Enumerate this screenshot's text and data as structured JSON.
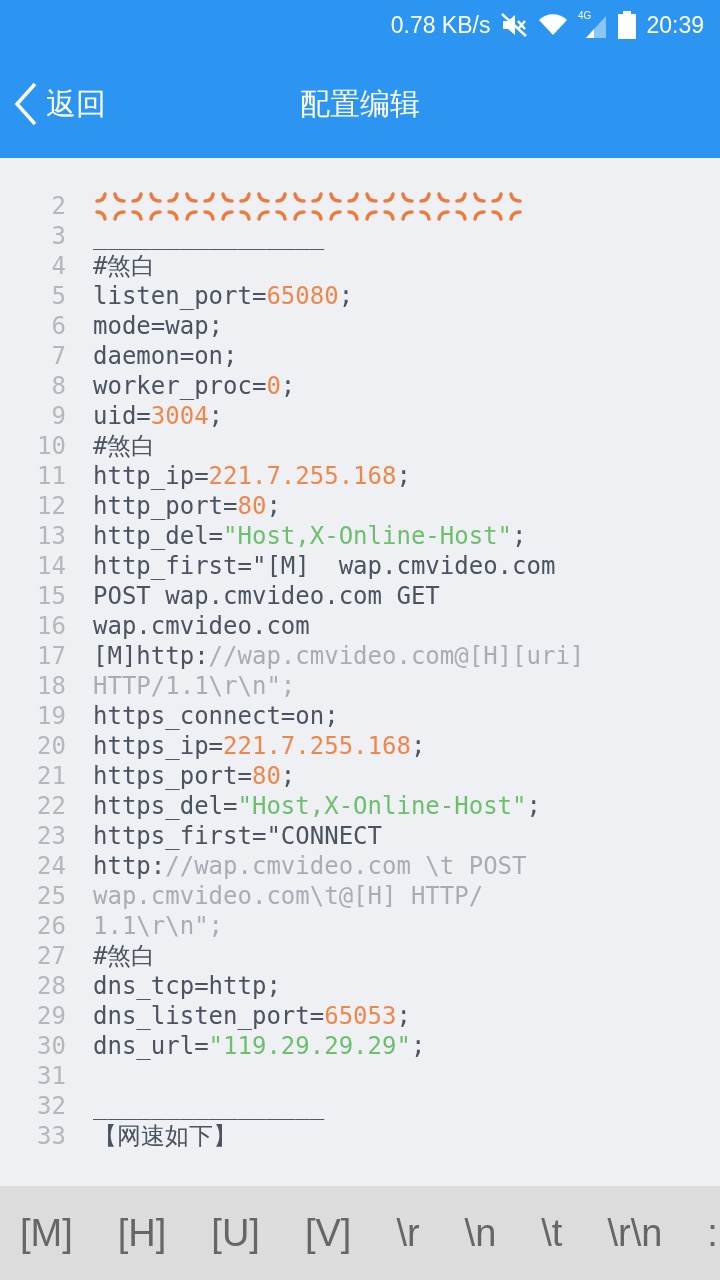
{
  "status_bar": {
    "speed": "0.78 KB/s",
    "network": "4G",
    "time": "20:39"
  },
  "header": {
    "back": "返回",
    "title": "配置编辑"
  },
  "lines": [
    {
      "n": "2",
      "kind": "icons",
      "icons": [
        {
          "kind": "anger"
        },
        {
          "kind": "anger"
        },
        {
          "kind": "anger"
        },
        {
          "kind": "anger"
        },
        {
          "kind": "anger"
        },
        {
          "kind": "anger"
        },
        {
          "kind": "anger"
        },
        {
          "kind": "anger"
        },
        {
          "kind": "anger"
        },
        {
          "kind": "anger"
        },
        {
          "kind": "anger"
        },
        {
          "kind": "anger"
        }
      ]
    },
    {
      "n": "3",
      "kind": "code",
      "parts": [
        {
          "t": "________________",
          "kind": "plain"
        }
      ]
    },
    {
      "n": "4",
      "kind": "code",
      "parts": [
        {
          "t": "#煞白",
          "kind": "plain"
        }
      ]
    },
    {
      "n": "5",
      "kind": "code",
      "parts": [
        {
          "t": "listen_port=",
          "kind": "plain"
        },
        {
          "t": "65080",
          "kind": "number"
        },
        {
          "t": ";",
          "kind": "plain"
        }
      ]
    },
    {
      "n": "6",
      "kind": "code",
      "parts": [
        {
          "t": "mode=wap;",
          "kind": "plain"
        }
      ]
    },
    {
      "n": "7",
      "kind": "code",
      "parts": [
        {
          "t": "daemon=on;",
          "kind": "plain"
        }
      ]
    },
    {
      "n": "8",
      "kind": "code",
      "parts": [
        {
          "t": "worker_proc=",
          "kind": "plain"
        },
        {
          "t": "0",
          "kind": "number"
        },
        {
          "t": ";",
          "kind": "plain"
        }
      ]
    },
    {
      "n": "9",
      "kind": "code",
      "parts": [
        {
          "t": "uid=",
          "kind": "plain"
        },
        {
          "t": "3004",
          "kind": "number"
        },
        {
          "t": ";",
          "kind": "plain"
        }
      ]
    },
    {
      "n": "10",
      "kind": "code",
      "parts": [
        {
          "t": "#煞白",
          "kind": "plain"
        }
      ]
    },
    {
      "n": "11",
      "kind": "code",
      "parts": [
        {
          "t": "http_ip=",
          "kind": "plain"
        },
        {
          "t": "221.7.255.168",
          "kind": "number"
        },
        {
          "t": ";",
          "kind": "plain"
        }
      ]
    },
    {
      "n": "12",
      "kind": "code",
      "parts": [
        {
          "t": "http_port=",
          "kind": "plain"
        },
        {
          "t": "80",
          "kind": "number"
        },
        {
          "t": ";",
          "kind": "plain"
        }
      ]
    },
    {
      "n": "13",
      "kind": "code",
      "parts": [
        {
          "t": "http_del=",
          "kind": "plain"
        },
        {
          "t": "\"Host,X-Online-Host\"",
          "kind": "string"
        },
        {
          "t": ";",
          "kind": "plain"
        }
      ]
    },
    {
      "n": "14",
      "kind": "code",
      "parts": [
        {
          "t": "http_first=\"[M]  wap.cmvideo.com",
          "kind": "plain"
        }
      ]
    },
    {
      "n": "15",
      "kind": "code",
      "parts": [
        {
          "t": "POST wap.cmvideo.com GET",
          "kind": "plain"
        }
      ]
    },
    {
      "n": "16",
      "kind": "code",
      "parts": [
        {
          "t": "wap.cmvideo.com",
          "kind": "plain"
        }
      ]
    },
    {
      "n": "17",
      "kind": "code",
      "parts": [
        {
          "t": "[M]http:",
          "kind": "plain"
        },
        {
          "t": "//wap.cmvideo.com@[H][uri]",
          "kind": "comment"
        }
      ]
    },
    {
      "n": "18",
      "kind": "code",
      "parts": [
        {
          "t": "HTTP/1.1\\r\\n\";",
          "kind": "comment"
        }
      ]
    },
    {
      "n": "19",
      "kind": "code",
      "parts": [
        {
          "t": "https_connect=on;",
          "kind": "plain"
        }
      ]
    },
    {
      "n": "20",
      "kind": "code",
      "parts": [
        {
          "t": "https_ip=",
          "kind": "plain"
        },
        {
          "t": "221.7.255.168",
          "kind": "number"
        },
        {
          "t": ";",
          "kind": "plain"
        }
      ]
    },
    {
      "n": "21",
      "kind": "code",
      "parts": [
        {
          "t": "https_port=",
          "kind": "plain"
        },
        {
          "t": "80",
          "kind": "number"
        },
        {
          "t": ";",
          "kind": "plain"
        }
      ]
    },
    {
      "n": "22",
      "kind": "code",
      "parts": [
        {
          "t": "https_del=",
          "kind": "plain"
        },
        {
          "t": "\"Host,X-Online-Host\"",
          "kind": "string"
        },
        {
          "t": ";",
          "kind": "plain"
        }
      ]
    },
    {
      "n": "23",
      "kind": "code",
      "parts": [
        {
          "t": "https_first=\"CONNECT",
          "kind": "plain"
        }
      ]
    },
    {
      "n": "24",
      "kind": "code",
      "parts": [
        {
          "t": "http:",
          "kind": "plain"
        },
        {
          "t": "//wap.cmvideo.com \\t POST",
          "kind": "comment"
        }
      ]
    },
    {
      "n": "25",
      "kind": "code",
      "parts": [
        {
          "t": "wap.cmvideo.com\\t@[H] HTTP/",
          "kind": "comment"
        }
      ]
    },
    {
      "n": "26",
      "kind": "code",
      "parts": [
        {
          "t": "1.1\\r\\n\";",
          "kind": "comment"
        }
      ]
    },
    {
      "n": "27",
      "kind": "code",
      "parts": [
        {
          "t": "#煞白",
          "kind": "plain"
        }
      ]
    },
    {
      "n": "28",
      "kind": "code",
      "parts": [
        {
          "t": "dns_tcp=http;",
          "kind": "plain"
        }
      ]
    },
    {
      "n": "29",
      "kind": "code",
      "parts": [
        {
          "t": "dns_listen_port=",
          "kind": "plain"
        },
        {
          "t": "65053",
          "kind": "number"
        },
        {
          "t": ";",
          "kind": "plain"
        }
      ]
    },
    {
      "n": "30",
      "kind": "code",
      "parts": [
        {
          "t": "dns_url=",
          "kind": "plain"
        },
        {
          "t": "\"119.29.29.29\"",
          "kind": "string"
        },
        {
          "t": ";",
          "kind": "plain"
        }
      ]
    },
    {
      "n": "31",
      "kind": "code"
    },
    {
      "n": "32",
      "kind": "code",
      "parts": [
        {
          "t": "________________",
          "kind": "plain"
        }
      ]
    },
    {
      "n": "33",
      "kind": "code",
      "parts": [
        {
          "t": "【网速如下】",
          "kind": "plain"
        }
      ]
    }
  ],
  "keys": [
    "[M]",
    "[H]",
    "[U]",
    "[V]",
    "\\r",
    "\\n",
    "\\t",
    "\\r\\n",
    ":"
  ]
}
